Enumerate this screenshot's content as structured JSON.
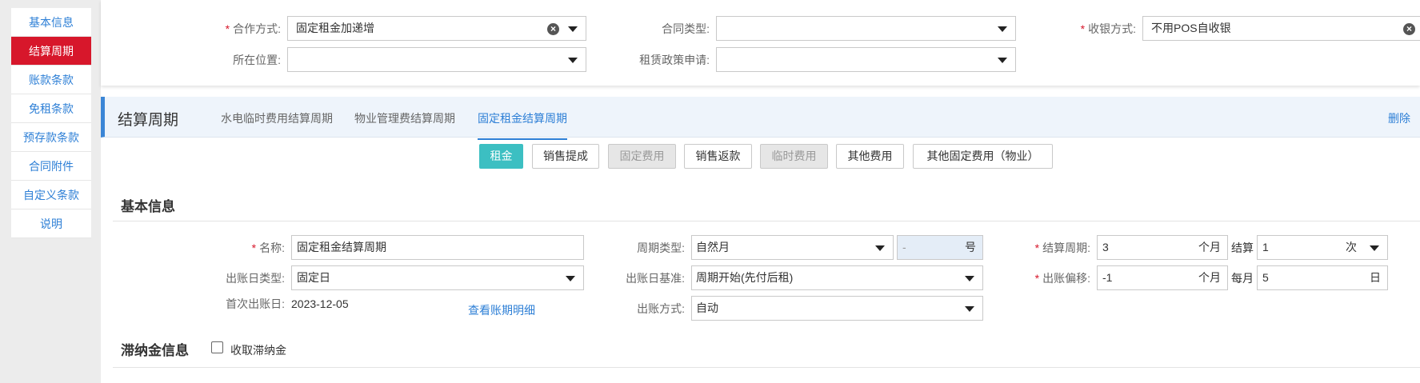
{
  "nav": {
    "items": [
      {
        "label": "基本信息"
      },
      {
        "label": "结算周期"
      },
      {
        "label": "账款条款"
      },
      {
        "label": "免租条款"
      },
      {
        "label": "预存款条款"
      },
      {
        "label": "合同附件"
      },
      {
        "label": "自定义条款"
      },
      {
        "label": "说明"
      }
    ],
    "active": "结算周期"
  },
  "top": {
    "coop_label": "合作方式:",
    "coop_value": "固定租金加递增",
    "contract_type_label": "合同类型:",
    "contract_type_value": "",
    "cashier_label": "收银方式:",
    "cashier_value": "不用POS自收银",
    "location_label": "所在位置:",
    "location_value": "",
    "lease_policy_label": "租赁政策申请:",
    "lease_policy_value": ""
  },
  "section": {
    "title": "结算周期",
    "tabs": [
      "水电临时费用结算周期",
      "物业管理费结算周期",
      "固定租金结算周期"
    ],
    "active_tab": "固定租金结算周期",
    "delete_label": "删除"
  },
  "fee_buttons": [
    {
      "label": "租金",
      "state": "primary"
    },
    {
      "label": "销售提成",
      "state": "normal"
    },
    {
      "label": "固定费用",
      "state": "disabled"
    },
    {
      "label": "销售返款",
      "state": "normal"
    },
    {
      "label": "临时费用",
      "state": "disabled"
    },
    {
      "label": "其他费用",
      "state": "normal"
    },
    {
      "label": "其他固定费用（物业）",
      "state": "normal"
    }
  ],
  "basic": {
    "title": "基本信息",
    "name_label": "名称:",
    "name_value": "固定租金结算周期",
    "billing_day_type_label": "出账日类型:",
    "billing_day_type_value": "固定日",
    "first_billing_label": "首次出账日:",
    "first_billing_value": "2023-12-05",
    "view_detail_link": "查看账期明细",
    "period_type_label": "周期类型:",
    "period_type_value": "自然月",
    "period_day_value": "-",
    "period_day_suffix": "号",
    "billing_basis_label": "出账日基准:",
    "billing_basis_value": "周期开始(先付后租)",
    "billing_method_label": "出账方式:",
    "billing_method_value": "自动",
    "settle_cycle_label": "结算周期:",
    "settle_cycle_value": "3",
    "settle_cycle_unit": "个月",
    "settle_label": "结算",
    "settle_times_value": "1",
    "settle_times_unit": "次",
    "offset_label": "出账偏移:",
    "offset_value": "-1",
    "offset_unit": "个月",
    "monthly_label": "每月",
    "monthly_day_value": "5",
    "monthly_day_unit": "日"
  },
  "late_fee": {
    "title": "滞纳金信息",
    "checkbox_label": "收取滞纳金"
  }
}
